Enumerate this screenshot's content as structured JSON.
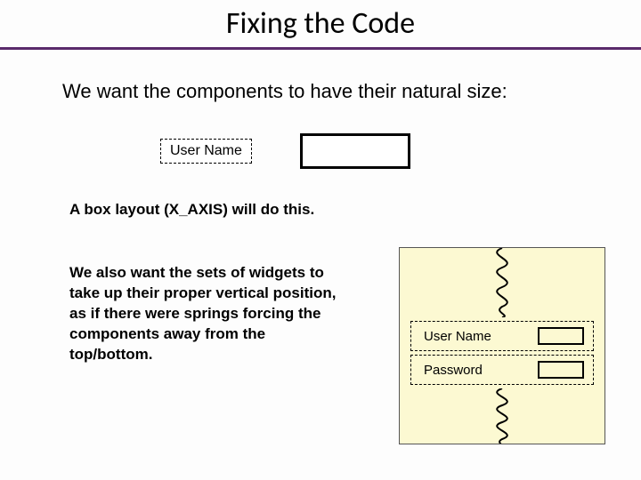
{
  "title": "Fixing the Code",
  "intro": "We want the components to have their natural size:",
  "example_label": "User Name",
  "para1": "A box layout (X_AXIS) will do this.",
  "para2": "We also want the sets of widgets to take up their proper vertical position, as if there were springs forcing the components away from the top/bottom.",
  "panel": {
    "row1_label": "User Name",
    "row2_label": "Password"
  }
}
